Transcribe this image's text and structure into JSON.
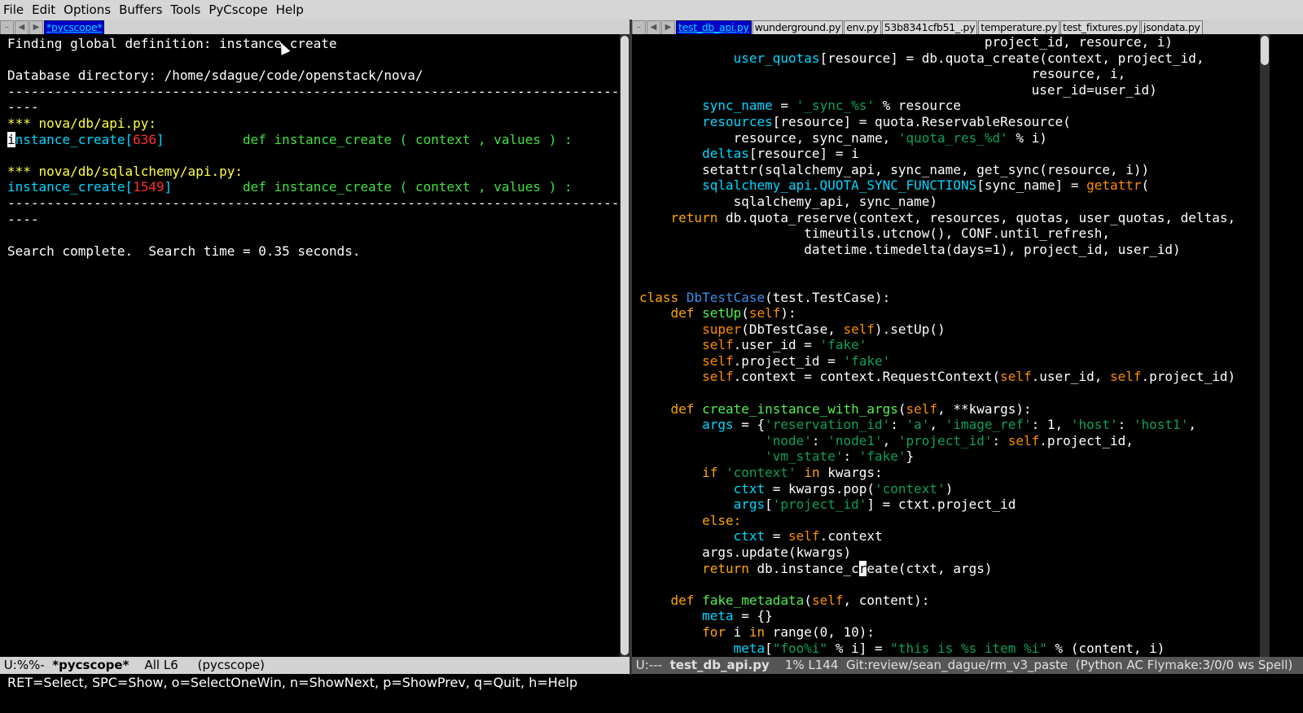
{
  "menu": [
    "File",
    "Edit",
    "Options",
    "Buffers",
    "Tools",
    "PyCscope",
    "Help"
  ],
  "left_tabs": [
    "*pycscope*"
  ],
  "right_tabs": [
    "test_db_api.py",
    "wunderground.py",
    "env.py",
    "53b8341cfb51_.py",
    "temperature.py",
    "test_fixtures.py",
    "jsondata.py"
  ],
  "left": {
    "line1_label": "Finding global definition: ",
    "line1_symbol": "instance_create",
    "dbdir": "Database directory: /home/sdague/code/openstack/nova/",
    "sep": "-------------------------------------------------------------------------------",
    "fold": "----",
    "file1": "*** nova/db/api.py:",
    "sym": "instance_create",
    "hit1_line": "636",
    "def_text": "def instance_create ( context , values ) :",
    "file2": "*** nova/db/sqlalchemy/api.py:",
    "hit2_line": "1549",
    "complete": "Search complete.  Search time = 0.35 seconds."
  },
  "left_modeline": {
    "state": "U:%%-",
    "buffer": "*pycscope*",
    "position": "All L6",
    "mode": "(pycscope)"
  },
  "right_modeline": {
    "state": "U:---",
    "buffer": "test_db_api.py",
    "position": "1% L144",
    "branch": "Git:review/sean_dague/rm_v3_paste",
    "mode": "(Python AC Flymake:3/0/0 ws Spell)"
  },
  "echo": "RET=Select, SPC=Show, o=SelectOneWin, n=ShowNext, p=ShowPrev, q=Quit, h=Help",
  "code": {
    "l01": "                                            project_id, resource, i)",
    "l02_a": "user_quotas",
    "l02_b": "[resource] = db.quota_create(context, project_id,",
    "l03": "                                                  resource, i,",
    "l04": "                                                  user_id=user_id)",
    "l05_a": "sync_name",
    "l05_b": " = ",
    "l05_c": "'_sync_%s'",
    "l05_d": " % resource",
    "l06_a": "resources",
    "l06_b": "[resource] = quota.ReservableResource(",
    "l07_a": "            resource, sync_name, ",
    "l07_b": "'quota_res_%d'",
    "l07_c": " % i)",
    "l08_a": "deltas",
    "l08_b": "[resource] = i",
    "l09": "setattr(sqlalchemy_api, sync_name, get_sync(resource, i))",
    "l10_a": "sqlalchemy_api.QUOTA_SYNC_FUNCTIONS",
    "l10_b": "[sync_name] = ",
    "l10_c": "getattr",
    "l10_d": "(",
    "l11": "            sqlalchemy_api, sync_name)",
    "l12_a": "return",
    "l12_b": " db.quota_reserve(context, resources, quotas, user_quotas, deltas,",
    "l13": "                     timeutils.utcnow(), CONF.until_refresh,",
    "l14": "                     datetime.timedelta(days=1), project_id, user_id)",
    "l17_a": "class",
    "l17_b": "DbTestCase",
    "l17_c": "(test.TestCase):",
    "l18_a": "def",
    "l18_b": "setUp",
    "l18_c": "(",
    "l18_d": "self",
    "l18_e": "):",
    "l19_a": "super",
    "l19_b": "(DbTestCase, ",
    "l19_c": "self",
    "l19_d": ").setUp()",
    "l20_a": "self",
    "l20_b": ".user_id = ",
    "l20_c": "'fake'",
    "l21_a": "self",
    "l21_b": ".project_id = ",
    "l21_c": "'fake'",
    "l22_a": "self",
    "l22_b": ".context = context.RequestContext(",
    "l22_c": "self",
    "l22_d": ".user_id, ",
    "l22_e": "self",
    "l22_f": ".project_id)",
    "l24_a": "def",
    "l24_b": "create_instance_with_args",
    "l24_c": "(",
    "l24_d": "self",
    "l24_e": ", **kwargs):",
    "l25_a": "args",
    "l25_b": " = {",
    "l25_c": "'reservation_id'",
    "l25_d": ": ",
    "l25_e": "'a'",
    "l25_f": ", ",
    "l25_g": "'image_ref'",
    "l25_h": ": 1, ",
    "l25_i": "'host'",
    "l25_j": ": ",
    "l25_k": "'host1'",
    "l25_l": ",",
    "l26_a": "'node'",
    "l26_b": ": ",
    "l26_c": "'node1'",
    "l26_d": ", ",
    "l26_e": "'project_id'",
    "l26_f": ": ",
    "l26_g": "self",
    "l26_h": ".project_id,",
    "l27_a": "'vm_state'",
    "l27_b": ": ",
    "l27_c": "'fake'",
    "l27_d": "}",
    "l28_a": "if",
    "l28_b": "'context'",
    "l28_c": "in",
    "l28_d": " kwargs:",
    "l29_a": "ctxt",
    "l29_b": " = kwargs.pop(",
    "l29_c": "'context'",
    "l29_d": ")",
    "l30_a": "args",
    "l30_b": "[",
    "l30_c": "'project_id'",
    "l30_d": "] = ctxt.project_id",
    "l31": "else:",
    "l32_a": "ctxt",
    "l32_b": " = ",
    "l32_c": "self",
    "l32_d": ".context",
    "l33": "args.update(kwargs)",
    "l34_a": "return",
    "l34_b": " db.instance_c",
    "l34_c": "r",
    "l34_d": "eate(ctxt, args)",
    "l36_a": "def",
    "l36_b": "fake_metadata",
    "l36_c": "(",
    "l36_d": "self",
    "l36_e": ", content):",
    "l37_a": "meta",
    "l37_b": " = {}",
    "l38_a": "for",
    "l38_b": " i ",
    "l38_c": "in",
    "l38_d": " range(0, 10):",
    "l39_a": "meta",
    "l39_b": "[",
    "l39_c": "\"foo%i\"",
    "l39_d": " % i] = ",
    "l39_e": "\"this is %s item %i\"",
    "l39_f": " % (content, i)"
  }
}
